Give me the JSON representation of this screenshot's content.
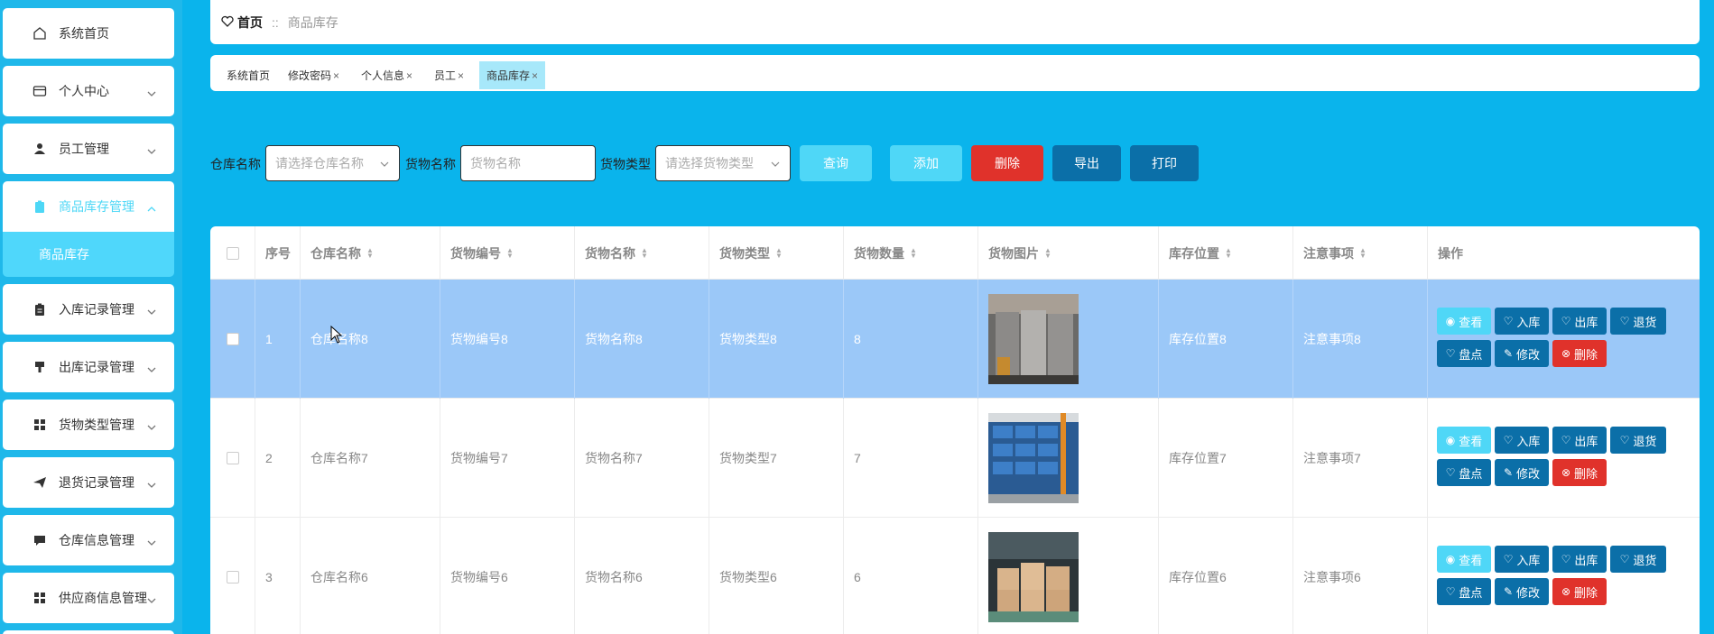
{
  "sidebar": {
    "items": [
      {
        "label": "系统首页",
        "icon": "home-icon"
      },
      {
        "label": "个人中心",
        "icon": "card-icon"
      },
      {
        "label": "员工管理",
        "icon": "user-icon"
      },
      {
        "label": "商品库存管理",
        "icon": "clipboard-icon",
        "active": true
      },
      {
        "label": "入库记录管理",
        "icon": "clipboard-icon"
      },
      {
        "label": "出库记录管理",
        "icon": "brush-icon"
      },
      {
        "label": "货物类型管理",
        "icon": "grid-icon"
      },
      {
        "label": "退货记录管理",
        "icon": "send-icon"
      },
      {
        "label": "仓库信息管理",
        "icon": "chat-icon"
      },
      {
        "label": "供应商信息管理",
        "icon": "grid-icon"
      }
    ],
    "submenu": {
      "label": "商品库存"
    }
  },
  "breadcrumb": {
    "home": "首页",
    "separator": "::",
    "current": "商品库存"
  },
  "tabs": [
    {
      "label": "系统首页",
      "closable": false
    },
    {
      "label": "修改密码",
      "closable": true
    },
    {
      "label": "个人信息",
      "closable": true
    },
    {
      "label": "员工",
      "closable": true
    },
    {
      "label": "商品库存",
      "closable": true,
      "active": true
    }
  ],
  "close_glyph": "×",
  "search": {
    "warehouse_label": "仓库名称",
    "warehouse_placeholder": "请选择仓库名称",
    "goods_name_label": "货物名称",
    "goods_name_placeholder": "货物名称",
    "goods_type_label": "货物类型",
    "goods_type_placeholder": "请选择货物类型",
    "query_button": "查询",
    "add_button": "添加",
    "delete_button": "删除",
    "export_button": "导出",
    "print_button": "打印"
  },
  "table": {
    "columns": [
      "序号",
      "仓库名称",
      "货物编号",
      "货物名称",
      "货物类型",
      "货物数量",
      "货物图片",
      "库存位置",
      "注意事项",
      "操作"
    ],
    "rows": [
      {
        "index": "1",
        "warehouse": "仓库名称8",
        "code": "货物编号8",
        "name": "货物名称8",
        "type": "货物类型8",
        "qty": "8",
        "location": "库存位置8",
        "note": "注意事项8",
        "selected": true
      },
      {
        "index": "2",
        "warehouse": "仓库名称7",
        "code": "货物编号7",
        "name": "货物名称7",
        "type": "货物类型7",
        "qty": "7",
        "location": "库存位置7",
        "note": "注意事项7"
      },
      {
        "index": "3",
        "warehouse": "仓库名称6",
        "code": "货物编号6",
        "name": "货物名称6",
        "type": "货物类型6",
        "qty": "6",
        "location": "库存位置6",
        "note": "注意事项6"
      }
    ],
    "actions": {
      "view": "查看",
      "stock_in": "入库",
      "stock_out": "出库",
      "return": "退货",
      "inventory": "盘点",
      "edit": "修改",
      "delete": "删除"
    }
  },
  "colors": {
    "background": "#0ab4ec",
    "accent": "#4fd7f7",
    "primary": "#0b6fa8",
    "danger": "#e0322b",
    "selected_row": "#9bc8f8"
  }
}
